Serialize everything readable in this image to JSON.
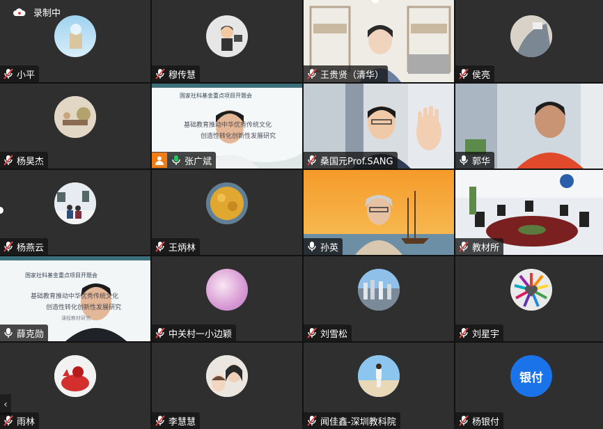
{
  "recording": {
    "label": "录制中"
  },
  "participants": [
    {
      "name": "小平",
      "mic": "muted"
    },
    {
      "name": "穆传慧",
      "mic": "muted"
    },
    {
      "name": "王贵贤（清华）",
      "mic": "muted"
    },
    {
      "name": "侯亮",
      "mic": "muted"
    },
    {
      "name": "杨昊杰",
      "mic": "muted"
    },
    {
      "name": "张广斌",
      "mic": "on"
    },
    {
      "name": "桑国元Prof.SANG",
      "mic": "muted"
    },
    {
      "name": "郭华",
      "mic": "on"
    },
    {
      "name": "杨燕云",
      "mic": "muted"
    },
    {
      "name": "王炳林",
      "mic": "muted"
    },
    {
      "name": "孙英",
      "mic": "on"
    },
    {
      "name": "教材所",
      "mic": "muted"
    },
    {
      "name": "薛克勋",
      "mic": "on"
    },
    {
      "name": "中关村一小边颖",
      "mic": "muted"
    },
    {
      "name": "刘雪松",
      "mic": "muted"
    },
    {
      "name": "刘星宇",
      "mic": "muted"
    },
    {
      "name": "雨林",
      "mic": "muted"
    },
    {
      "name": "李慧慧",
      "mic": "muted"
    },
    {
      "name": "闻佳鑫-深圳教科院",
      "mic": "muted"
    },
    {
      "name": "杨银付",
      "mic": "muted"
    }
  ],
  "slides": {
    "header": "国家社科基金重点项目开题会",
    "line1": "基础教育推动中华优秀传统文化",
    "line2": "创造性转化创新性发展研究",
    "sub": "课程教材研究"
  },
  "avatar_text": {
    "yinfu": "银付"
  },
  "colors": {
    "speaking": "#22c55e",
    "muted": "#e04444",
    "accent_blue": "#1a73e8",
    "badge_orange": "#f07c16"
  }
}
